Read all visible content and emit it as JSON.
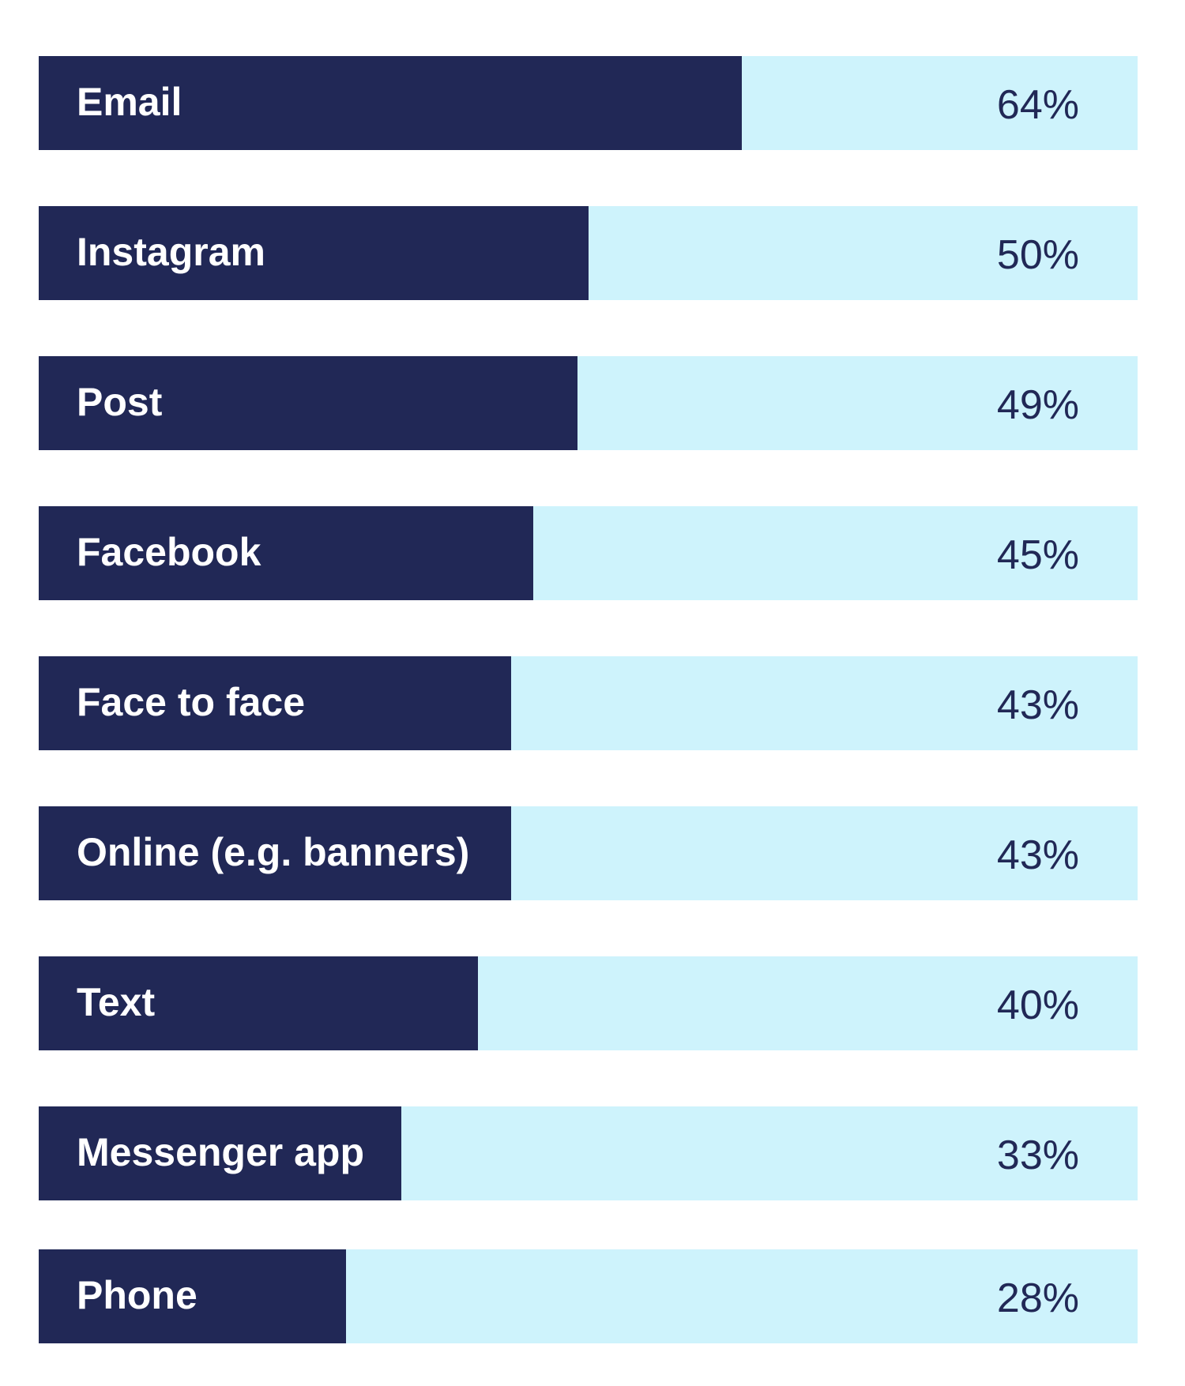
{
  "chart_data": {
    "type": "bar",
    "orientation": "horizontal",
    "title": "",
    "xlabel": "",
    "ylabel": "",
    "xlim": [
      0,
      100
    ],
    "unit": "%",
    "grid": false,
    "legend": "none",
    "categories": [
      "Email",
      "Instagram",
      "Post",
      "Facebook",
      "Face to face",
      "Online (e.g. banners)",
      "Text",
      "Messenger app",
      "Phone"
    ],
    "values": [
      64,
      50,
      49,
      45,
      43,
      43,
      40,
      33,
      28
    ],
    "value_labels": [
      "64%",
      "50%",
      "49%",
      "45%",
      "43%",
      "43%",
      "40%",
      "33%",
      "28%"
    ]
  },
  "colors": {
    "bar": "#212856",
    "track": "#CEF3FC",
    "label_text": "#FFFFFF",
    "value_text": "#212856"
  }
}
